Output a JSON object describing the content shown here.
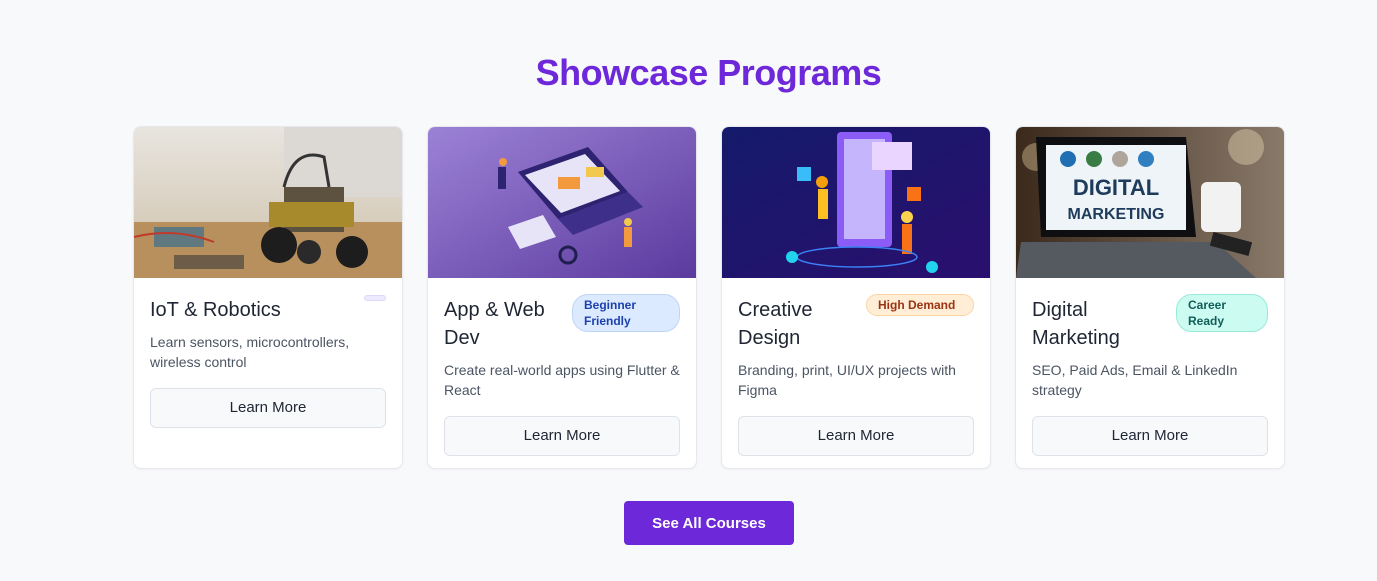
{
  "section": {
    "title": "Showcase Programs"
  },
  "cards": [
    {
      "title": "IoT & Robotics",
      "badge": "",
      "description": "Learn sensors, microcontrollers, wireless control",
      "button": "Learn More",
      "image_icon": "robot-car-photo"
    },
    {
      "title": "App & Web Dev",
      "badge": "Beginner Friendly",
      "description": "Create real-world apps using Flutter & React",
      "button": "Learn More",
      "image_icon": "laptop-illustration"
    },
    {
      "title": "Creative Design",
      "badge": "High Demand",
      "description": "Branding, print, UI/UX projects with Figma",
      "button": "Learn More",
      "image_icon": "design-illustration"
    },
    {
      "title": "Digital Marketing",
      "badge": "Career Ready",
      "description": "SEO, Paid Ads, Email & LinkedIn strategy",
      "button": "Learn More",
      "image_icon": "laptop-photo",
      "image_text": [
        "DIGITAL",
        "MARKETING"
      ]
    }
  ],
  "cta": {
    "label": "See All Courses"
  },
  "colors": {
    "accent": "#6d28d9",
    "badge_blue": "#dbeafe",
    "badge_orange": "#ffedd5",
    "badge_teal": "#ccfbf1"
  }
}
